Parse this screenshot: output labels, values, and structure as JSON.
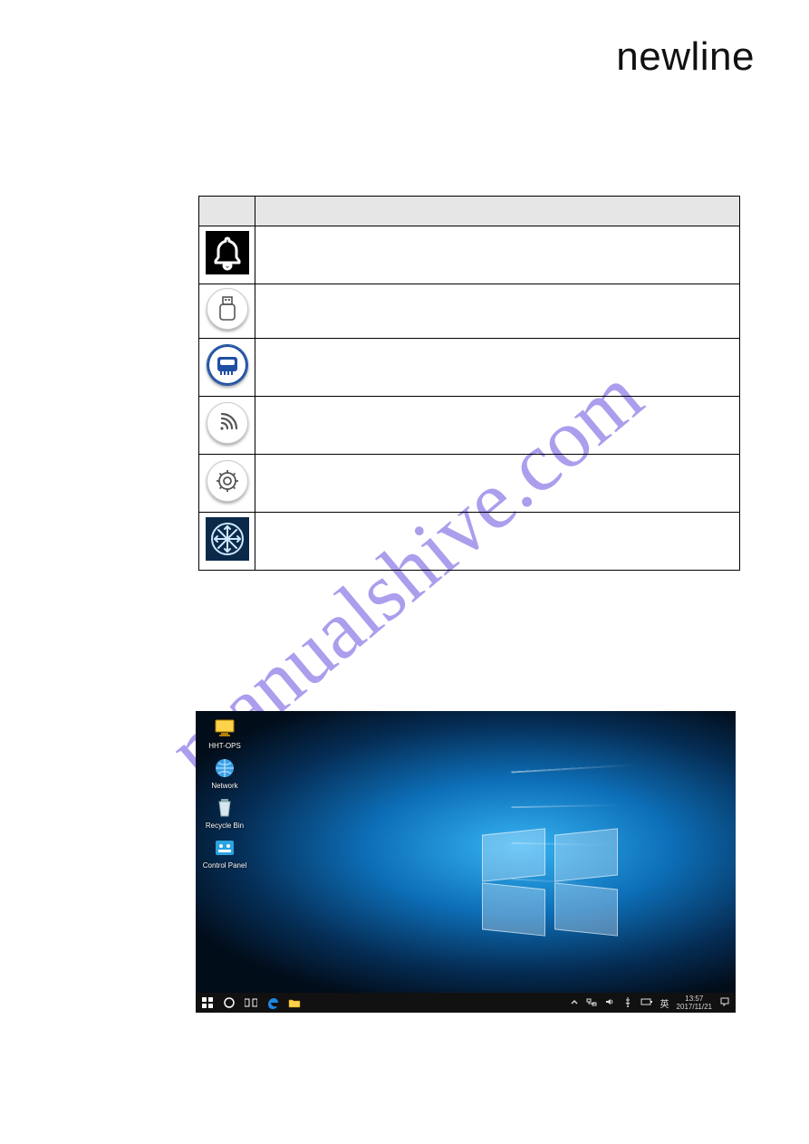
{
  "brand": "newline",
  "watermark": "manualshive.com",
  "icon_table": {
    "header": {
      "icon_col": "",
      "desc_col": ""
    },
    "rows": [
      {
        "key": "bell",
        "name": "bell-icon",
        "desc": ""
      },
      {
        "key": "usb",
        "name": "usb-icon",
        "desc": ""
      },
      {
        "key": "chip",
        "name": "chip-icon",
        "desc": ""
      },
      {
        "key": "wifi",
        "name": "wifi-icon",
        "desc": ""
      },
      {
        "key": "gear",
        "name": "gear-icon",
        "desc": ""
      },
      {
        "key": "snow",
        "name": "freeze-icon",
        "desc": ""
      }
    ]
  },
  "windows_screenshot": {
    "desktop_icons": [
      {
        "name": "hht-ops",
        "label": "HHT-OPS",
        "glyph": "computer"
      },
      {
        "name": "network",
        "label": "Network",
        "glyph": "globe"
      },
      {
        "name": "recycle-bin",
        "label": "Recycle Bin",
        "glyph": "bin"
      },
      {
        "name": "control-panel",
        "label": "Control Panel",
        "glyph": "panel"
      }
    ],
    "taskbar": {
      "left": [
        {
          "name": "start-icon",
          "glyph": "winstart"
        },
        {
          "name": "cortana-icon",
          "glyph": "circle"
        },
        {
          "name": "taskview-icon",
          "glyph": "taskview"
        },
        {
          "name": "edge-icon",
          "glyph": "edge"
        },
        {
          "name": "file-explorer-icon",
          "glyph": "folder"
        }
      ],
      "right": [
        {
          "name": "chevron-up-icon",
          "glyph": "chevup"
        },
        {
          "name": "network-tray-icon",
          "glyph": "net"
        },
        {
          "name": "volume-tray-icon",
          "glyph": "vol"
        },
        {
          "name": "usb-tray-icon",
          "glyph": "plug"
        },
        {
          "name": "ime-tray-icon",
          "glyph": "ime",
          "text": "英"
        },
        {
          "name": "battery-tray-icon",
          "glyph": "batt"
        }
      ],
      "clock": {
        "time": "13:57",
        "date": "2017/11/21"
      },
      "action_center": {
        "name": "action-center-icon"
      }
    }
  }
}
